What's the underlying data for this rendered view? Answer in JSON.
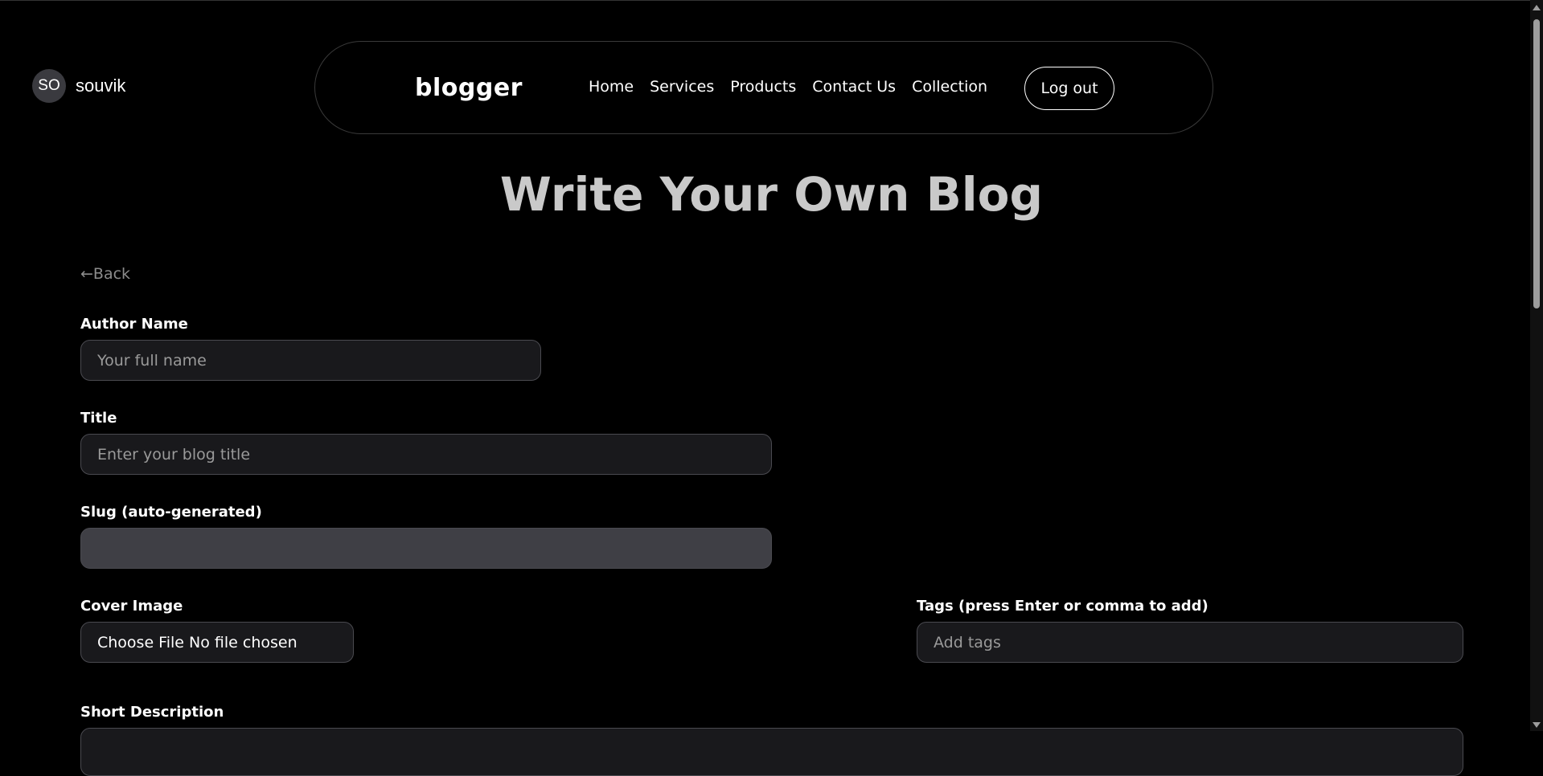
{
  "user": {
    "initials": "SO",
    "name": "souvik"
  },
  "nav": {
    "logo": "blogger",
    "links": [
      "Home",
      "Services",
      "Products",
      "Contact Us",
      "Collection"
    ],
    "logout_label": "Log out"
  },
  "page": {
    "title": "Write Your Own Blog",
    "back_label": "←Back"
  },
  "form": {
    "author": {
      "label": "Author Name",
      "placeholder": "Your full name"
    },
    "title": {
      "label": "Title",
      "placeholder": "Enter your blog title"
    },
    "slug": {
      "label": "Slug (auto-generated)",
      "value": ""
    },
    "cover": {
      "label": "Cover Image",
      "button": "Choose File",
      "status": "No file chosen"
    },
    "tags": {
      "label": "Tags (press Enter or comma to add)",
      "placeholder": "Add tags"
    },
    "short_description": {
      "label": "Short Description"
    }
  }
}
